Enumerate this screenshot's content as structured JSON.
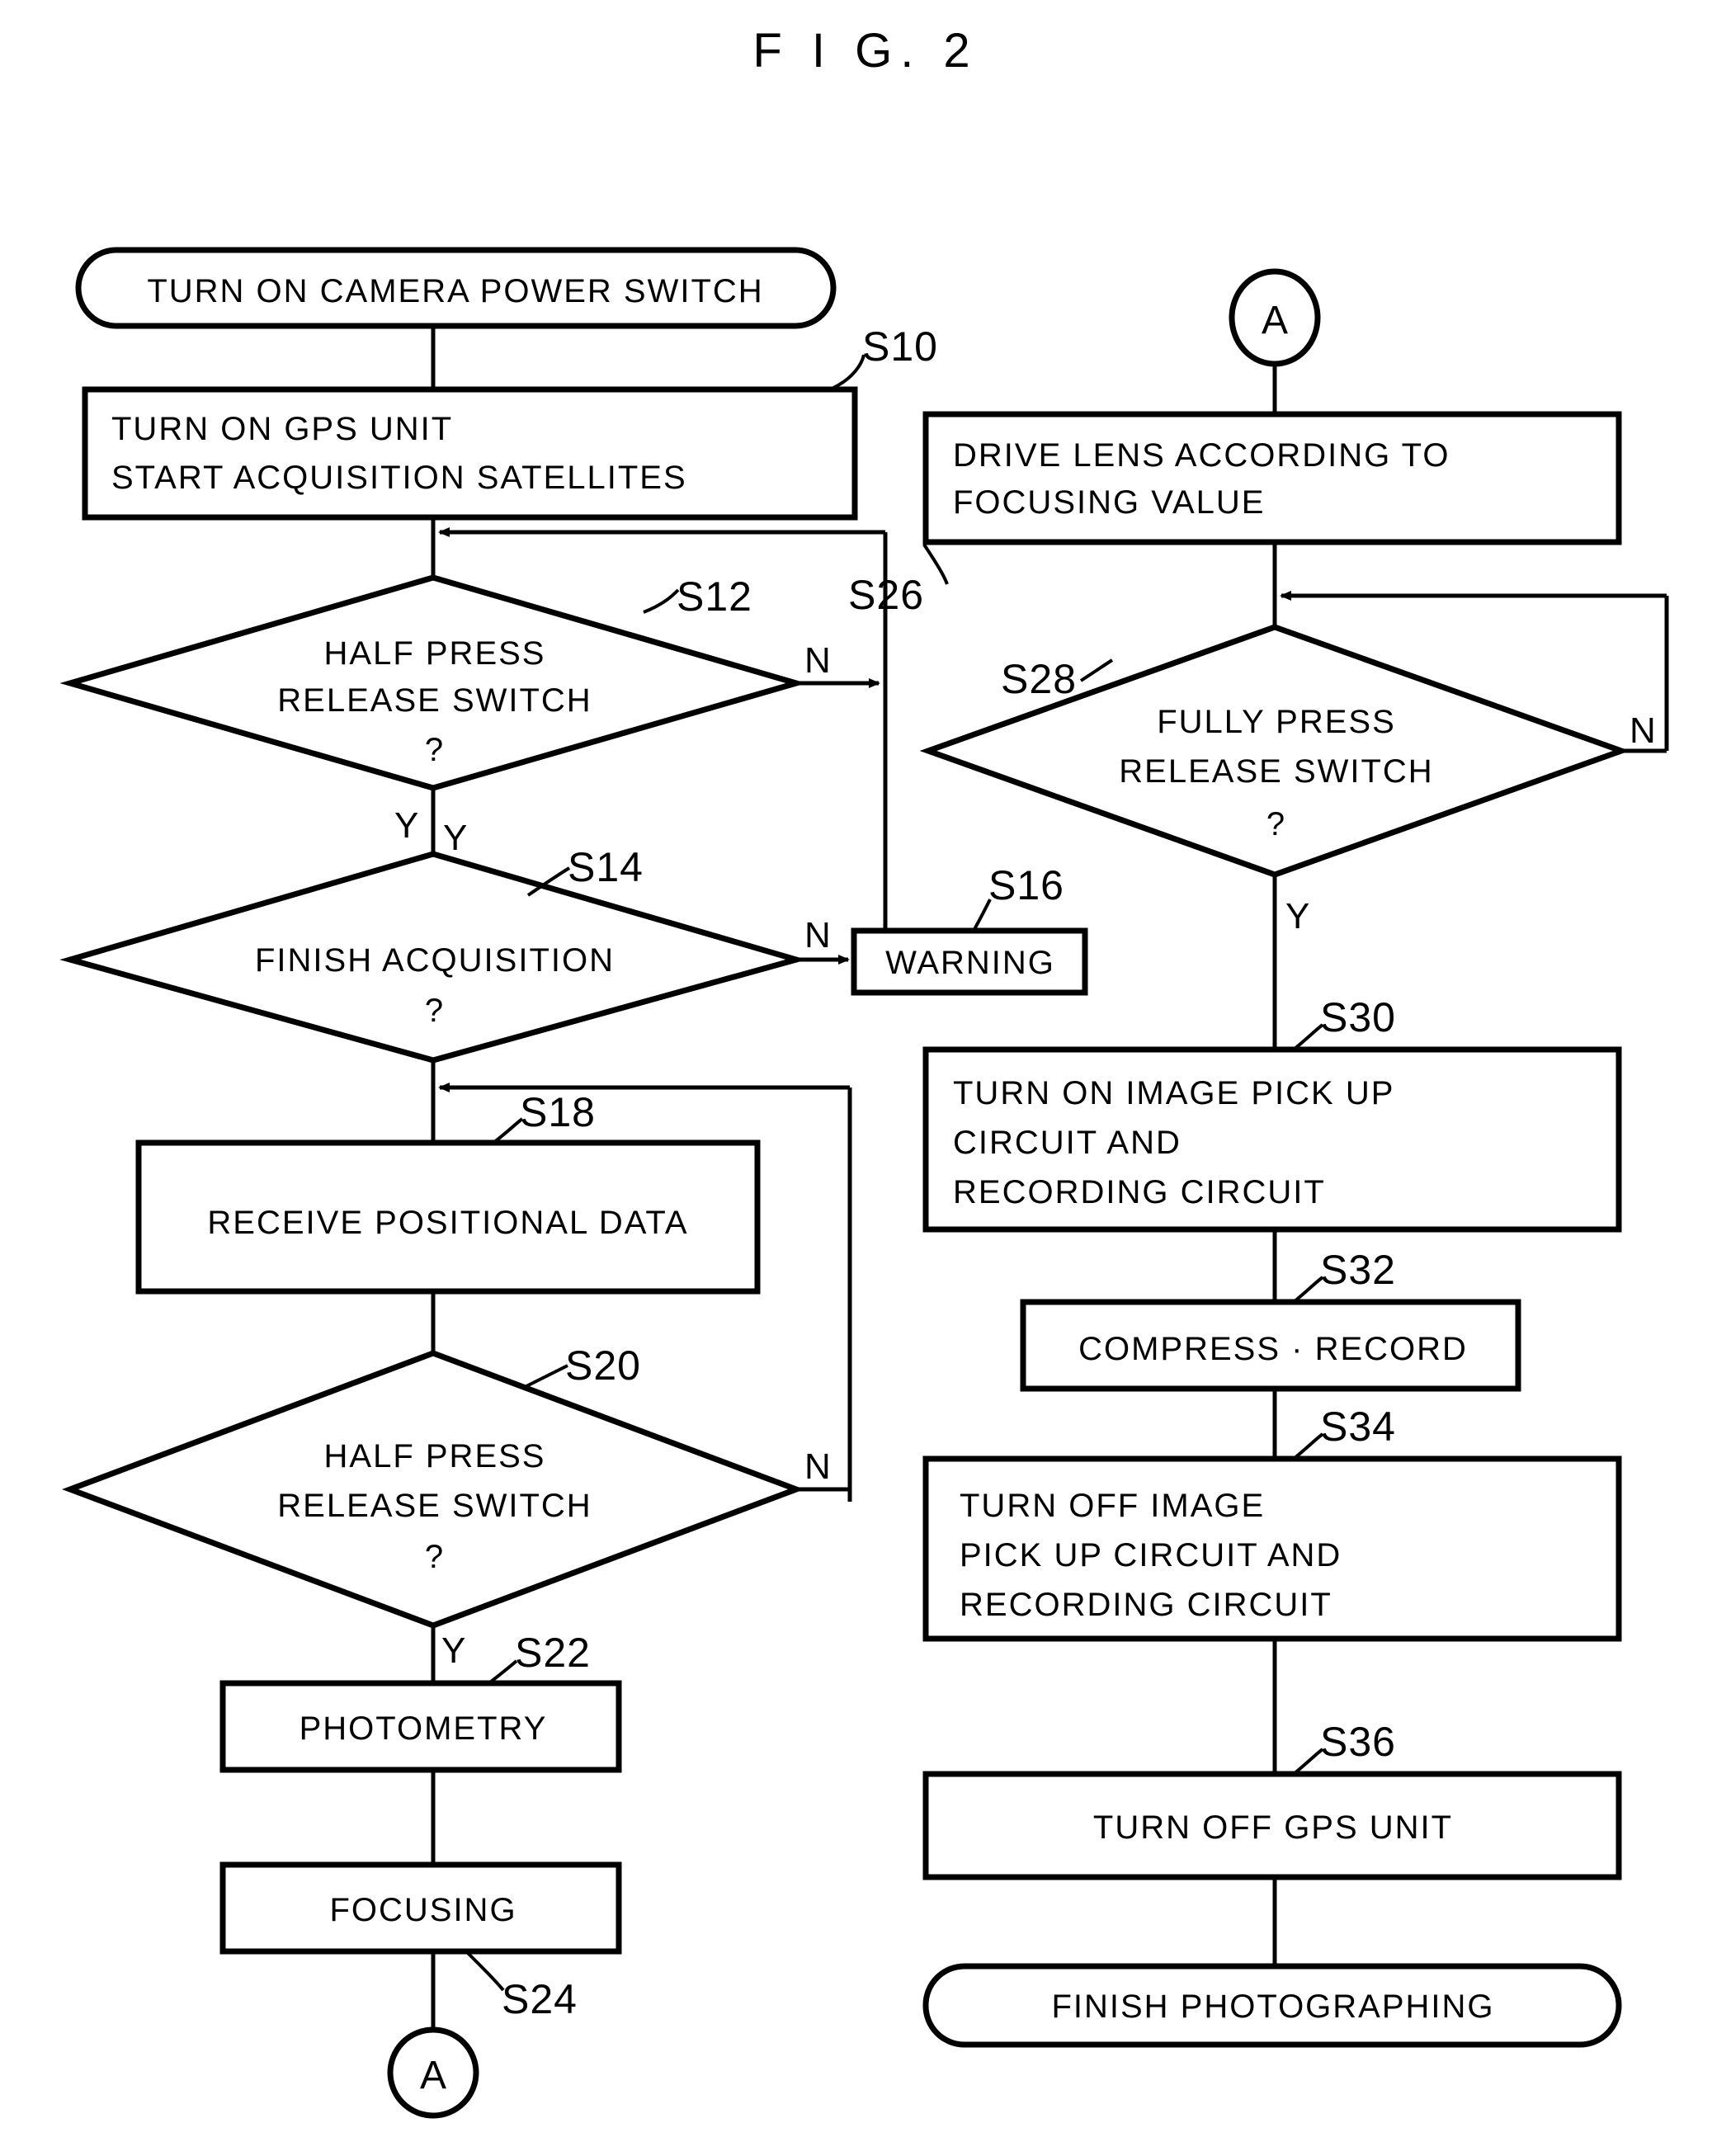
{
  "figure": {
    "title": "F I G. 2",
    "type": "flowchart"
  },
  "nodes": {
    "start": {
      "label": "TURN ON CAMERA POWER SWITCH",
      "shape": "terminator"
    },
    "s10": {
      "step": "S10",
      "line1": "TURN ON GPS  UNIT",
      "line2": "START ACQUISITION SATELLITES",
      "shape": "process"
    },
    "s12": {
      "step": "S12",
      "line1": "HALF PRESS",
      "line2": "RELEASE SWITCH",
      "line3": "?",
      "shape": "decision",
      "yes": "Y",
      "no": "N"
    },
    "s14": {
      "step": "S14",
      "line1": "FINISH ACQUISITION",
      "line2": "?",
      "shape": "decision",
      "yes": "Y",
      "no": "N"
    },
    "s16": {
      "step": "S16",
      "label": "WARNING",
      "shape": "process"
    },
    "s18": {
      "step": "S18",
      "label": "RECEIVE POSITIONAL DATA",
      "shape": "process"
    },
    "s20": {
      "step": "S20",
      "line1": "HALF PRESS",
      "line2": "RELEASE SWITCH",
      "line3": "?",
      "shape": "decision",
      "yes": "Y",
      "no": "N"
    },
    "s22": {
      "step": "S22",
      "label": "PHOTOMETRY",
      "shape": "process"
    },
    "s24": {
      "step": "S24",
      "label": "FOCUSING",
      "shape": "process"
    },
    "connector_a_out": {
      "label": "A",
      "shape": "connector"
    },
    "connector_a_in": {
      "label": "A",
      "shape": "connector"
    },
    "s26": {
      "step": "S26",
      "line1": "DRIVE LENS ACCORDING TO",
      "line2": "FOCUSING VALUE",
      "shape": "process"
    },
    "s28": {
      "step": "S28",
      "line1": "FULLY PRESS",
      "line2": "RELEASE SWITCH",
      "line3": "?",
      "shape": "decision",
      "yes": "Y",
      "no": "N"
    },
    "s30": {
      "step": "S30",
      "line1": "TURN ON IMAGE PICK UP",
      "line2": "CIRCUIT AND",
      "line3": "RECORDING CIRCUIT",
      "shape": "process"
    },
    "s32": {
      "step": "S32",
      "label": "COMPRESS · RECORD",
      "shape": "process"
    },
    "s34": {
      "step": "S34",
      "line1": "TURN OFF IMAGE",
      "line2": "PICK UP CIRCUIT AND",
      "line3": "RECORDING CIRCUIT",
      "shape": "process"
    },
    "s36": {
      "step": "S36",
      "label": "TURN OFF GPS UNIT",
      "shape": "process"
    },
    "end": {
      "label": "FINISH  PHOTOGRAPHING",
      "shape": "terminator"
    }
  },
  "colors": {
    "stroke": "#000000",
    "fill": "#ffffff",
    "background": "#ffffff"
  }
}
